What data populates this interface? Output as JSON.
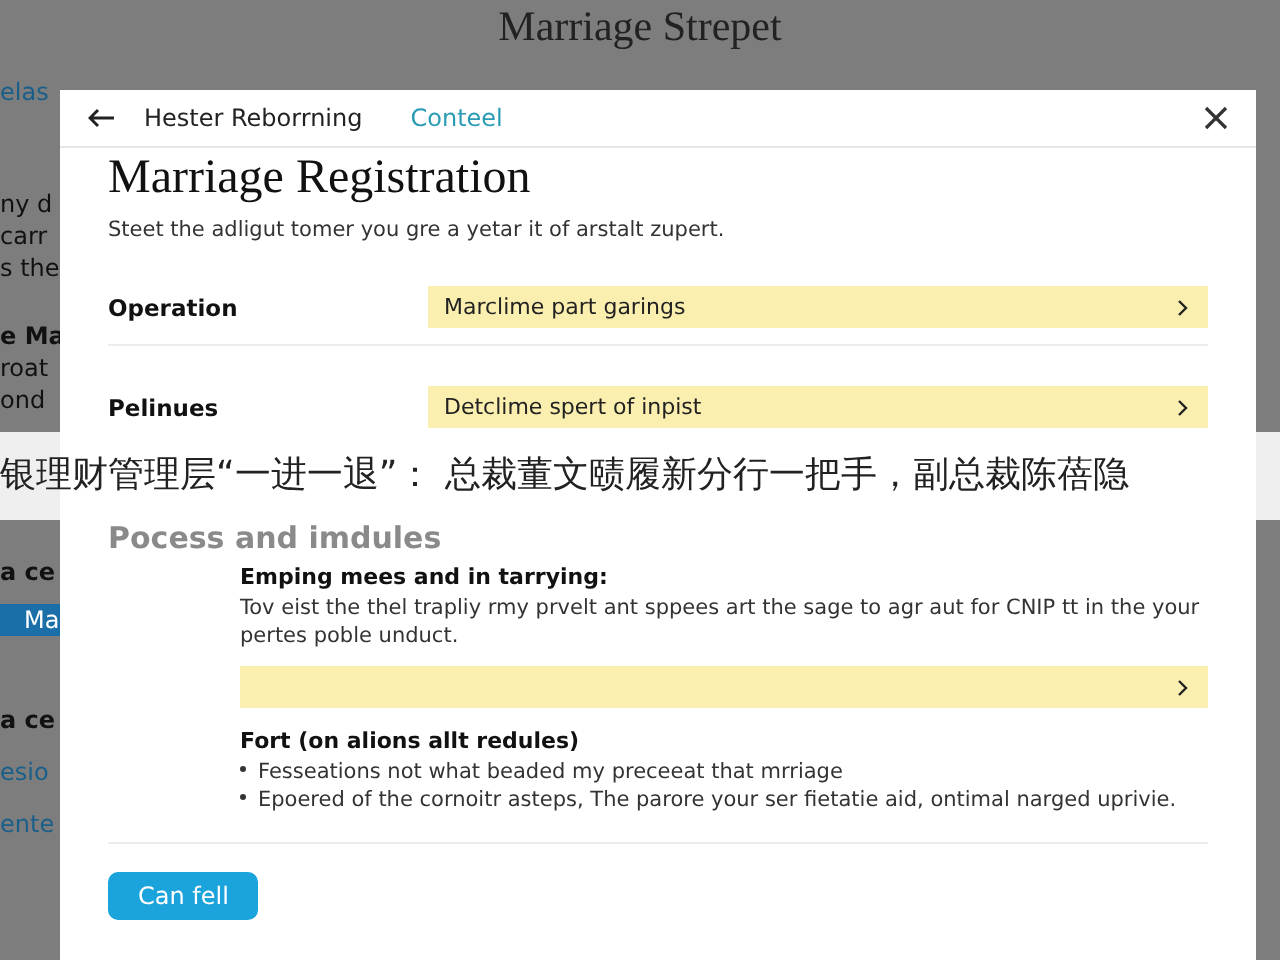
{
  "background": {
    "title": "Marriage Strepet",
    "fragments": [
      {
        "text": "elas",
        "kind": "link"
      },
      {
        "text": "ny d",
        "kind": "plain"
      },
      {
        "text": "carr",
        "kind": "plain"
      },
      {
        "text": "s the",
        "kind": "plain"
      },
      {
        "text": "e Ma",
        "kind": "heading"
      },
      {
        "text": "roat",
        "kind": "plain"
      },
      {
        "text": "ond",
        "kind": "plain"
      },
      {
        "text": "a ce",
        "kind": "heading"
      },
      {
        "text": "Ma",
        "kind": "button"
      },
      {
        "text": "a ce",
        "kind": "heading"
      },
      {
        "text": "esio",
        "kind": "link"
      },
      {
        "text": "ente",
        "kind": "link"
      }
    ]
  },
  "dialog": {
    "header": {
      "back_label": "Hester Reborrning",
      "link": "Conteel"
    },
    "title": "Marriage Registration",
    "subtitle": "Steet the adligut tomer you gre a yetar it of arstalt zupert.",
    "fields": [
      {
        "label": "Operation",
        "value": "Marclime part garings"
      },
      {
        "label": "Pelinues",
        "value": "Detclime spert of inpist"
      }
    ],
    "section_title": "Pocess and imdules",
    "block": {
      "heading": "Emping mees and in tarrying:",
      "text": "Tov eist the thel trapliy rmy prvelt ant sppees art the sage to agr aut for CNIP tt in the your pertes poble unduct."
    },
    "notes": {
      "heading": "Fort (on alions allt redules)",
      "items": [
        "Fesseations not what beaded my preceeat that mrriage",
        "Epoered of the cornoitr asteps, The parore your ser fietatie aid, ontimal narged uprivie."
      ]
    },
    "button": "Can fell"
  },
  "banner": "银理财管理层“一进一退”： 总裁董文赜履新分行一把手，副总裁陈蓓隐"
}
